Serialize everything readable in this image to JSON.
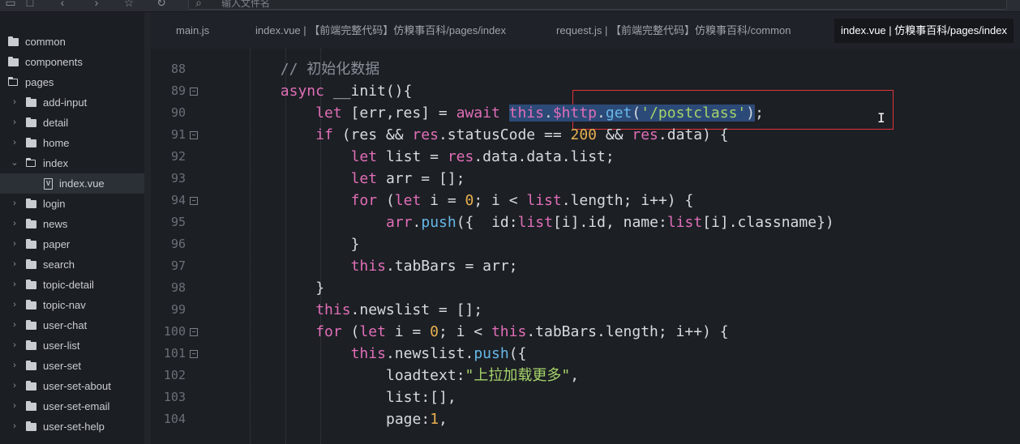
{
  "toolbar": {
    "search_placeholder": "输入文件名"
  },
  "sidebar": {
    "items": [
      {
        "label": "common",
        "type": "folder",
        "depth": 0,
        "expanded": false,
        "has_chevron": false
      },
      {
        "label": "components",
        "type": "folder",
        "depth": 0,
        "expanded": false,
        "has_chevron": false
      },
      {
        "label": "pages",
        "type": "folder",
        "depth": 0,
        "expanded": true,
        "has_chevron": false
      },
      {
        "label": "add-input",
        "type": "folder",
        "depth": 1,
        "expanded": false,
        "has_chevron": true
      },
      {
        "label": "detail",
        "type": "folder",
        "depth": 1,
        "expanded": false,
        "has_chevron": true
      },
      {
        "label": "home",
        "type": "folder",
        "depth": 1,
        "expanded": false,
        "has_chevron": true
      },
      {
        "label": "index",
        "type": "folder",
        "depth": 1,
        "expanded": true,
        "has_chevron": true
      },
      {
        "label": "index.vue",
        "type": "vue",
        "depth": 2,
        "selected": true
      },
      {
        "label": "login",
        "type": "folder",
        "depth": 1,
        "expanded": false,
        "has_chevron": true
      },
      {
        "label": "news",
        "type": "folder",
        "depth": 1,
        "expanded": false,
        "has_chevron": true
      },
      {
        "label": "paper",
        "type": "folder",
        "depth": 1,
        "expanded": false,
        "has_chevron": true
      },
      {
        "label": "search",
        "type": "folder",
        "depth": 1,
        "expanded": false,
        "has_chevron": true
      },
      {
        "label": "topic-detail",
        "type": "folder",
        "depth": 1,
        "expanded": false,
        "has_chevron": true
      },
      {
        "label": "topic-nav",
        "type": "folder",
        "depth": 1,
        "expanded": false,
        "has_chevron": true
      },
      {
        "label": "user-chat",
        "type": "folder",
        "depth": 1,
        "expanded": false,
        "has_chevron": true
      },
      {
        "label": "user-list",
        "type": "folder",
        "depth": 1,
        "expanded": false,
        "has_chevron": true
      },
      {
        "label": "user-set",
        "type": "folder",
        "depth": 1,
        "expanded": false,
        "has_chevron": true
      },
      {
        "label": "user-set-about",
        "type": "folder",
        "depth": 1,
        "expanded": false,
        "has_chevron": true
      },
      {
        "label": "user-set-email",
        "type": "folder",
        "depth": 1,
        "expanded": false,
        "has_chevron": true
      },
      {
        "label": "user-set-help",
        "type": "folder",
        "depth": 1,
        "expanded": false,
        "has_chevron": true
      }
    ]
  },
  "tabs": [
    {
      "label": "main.js",
      "active": false
    },
    {
      "label": "index.vue | 【前端完整代码】仿糗事百科/pages/index",
      "active": false
    },
    {
      "label": "request.js | 【前端完整代码】仿糗事百科/common",
      "active": false
    },
    {
      "label": "index.vue | 仿糗事百科/pages/index",
      "active": true
    }
  ],
  "editor": {
    "lines": [
      {
        "num": "88",
        "fold": false,
        "indent": 2,
        "tokens": [
          [
            "cm",
            "// 初始化数据"
          ]
        ]
      },
      {
        "num": "89",
        "fold": true,
        "indent": 2,
        "tokens": [
          [
            "kw",
            "async"
          ],
          [
            "op",
            " __init(){"
          ]
        ]
      },
      {
        "num": "90",
        "fold": false,
        "indent": 3,
        "tokens": [
          [
            "kw",
            "let"
          ],
          [
            "op",
            " [err,res] = "
          ],
          [
            "kw",
            "await"
          ],
          [
            "op",
            " "
          ],
          [
            "kw sel",
            "this"
          ],
          [
            "op sel",
            "."
          ],
          [
            "kw sel",
            "$http"
          ],
          [
            "op sel",
            "."
          ],
          [
            "fn sel",
            "get"
          ],
          [
            "op sel",
            "("
          ],
          [
            "str sel",
            "'/postclass'"
          ],
          [
            "op sel",
            ")"
          ],
          [
            "op",
            ";"
          ]
        ]
      },
      {
        "num": "91",
        "fold": true,
        "indent": 3,
        "tokens": [
          [
            "kw",
            "if"
          ],
          [
            "op",
            " (res && "
          ],
          [
            "kw",
            "res"
          ],
          [
            "op",
            ".statusCode == "
          ],
          [
            "num",
            "200"
          ],
          [
            "op",
            " && "
          ],
          [
            "kw",
            "res"
          ],
          [
            "op",
            ".data) {"
          ]
        ]
      },
      {
        "num": "92",
        "fold": false,
        "indent": 4,
        "tokens": [
          [
            "kw",
            "let"
          ],
          [
            "op",
            " list = "
          ],
          [
            "kw",
            "res"
          ],
          [
            "op",
            ".data.data.list;"
          ]
        ]
      },
      {
        "num": "93",
        "fold": false,
        "indent": 4,
        "tokens": [
          [
            "kw",
            "let"
          ],
          [
            "op",
            " arr = [];"
          ]
        ]
      },
      {
        "num": "94",
        "fold": true,
        "indent": 4,
        "tokens": [
          [
            "kw",
            "for"
          ],
          [
            "op",
            " ("
          ],
          [
            "kw",
            "let"
          ],
          [
            "op",
            " i = "
          ],
          [
            "num",
            "0"
          ],
          [
            "op",
            "; i < "
          ],
          [
            "kw",
            "list"
          ],
          [
            "op",
            ".length; i++) {"
          ]
        ]
      },
      {
        "num": "95",
        "fold": false,
        "indent": 5,
        "tokens": [
          [
            "kw",
            "arr"
          ],
          [
            "op",
            "."
          ],
          [
            "fn",
            "push"
          ],
          [
            "op",
            "({  id:"
          ],
          [
            "kw",
            "list"
          ],
          [
            "op",
            "[i].id, name:"
          ],
          [
            "kw",
            "list"
          ],
          [
            "op",
            "[i].classname})"
          ]
        ]
      },
      {
        "num": "96",
        "fold": false,
        "indent": 4,
        "tokens": [
          [
            "op",
            "}"
          ]
        ]
      },
      {
        "num": "97",
        "fold": false,
        "indent": 4,
        "tokens": [
          [
            "kw",
            "this"
          ],
          [
            "op",
            ".tabBars = arr;"
          ]
        ]
      },
      {
        "num": "98",
        "fold": false,
        "indent": 3,
        "tokens": [
          [
            "op",
            "}"
          ]
        ]
      },
      {
        "num": "99",
        "fold": false,
        "indent": 3,
        "tokens": [
          [
            "kw",
            "this"
          ],
          [
            "op",
            ".newslist = [];"
          ]
        ]
      },
      {
        "num": "100",
        "fold": true,
        "indent": 3,
        "tokens": [
          [
            "kw",
            "for"
          ],
          [
            "op",
            " ("
          ],
          [
            "kw",
            "let"
          ],
          [
            "op",
            " i = "
          ],
          [
            "num",
            "0"
          ],
          [
            "op",
            "; i < "
          ],
          [
            "kw",
            "this"
          ],
          [
            "op",
            ".tabBars.length; i++) {"
          ]
        ]
      },
      {
        "num": "101",
        "fold": true,
        "indent": 4,
        "tokens": [
          [
            "kw",
            "this"
          ],
          [
            "op",
            ".newslist."
          ],
          [
            "fn",
            "push"
          ],
          [
            "op",
            "({"
          ]
        ]
      },
      {
        "num": "102",
        "fold": false,
        "indent": 5,
        "tokens": [
          [
            "op",
            "loadtext:"
          ],
          [
            "str",
            "\"上拉加载更多\""
          ],
          [
            "op",
            ","
          ]
        ]
      },
      {
        "num": "103",
        "fold": false,
        "indent": 5,
        "tokens": [
          [
            "op",
            "list:[],"
          ]
        ]
      },
      {
        "num": "104",
        "fold": false,
        "indent": 5,
        "tokens": [
          [
            "op",
            "page:"
          ],
          [
            "num",
            "1"
          ],
          [
            "op",
            ","
          ]
        ]
      }
    ]
  },
  "colors": {
    "keyword": "#e06eb7",
    "function": "#66b8e8",
    "string": "#a6d36a",
    "number": "#e8b050",
    "comment": "#8a8f98",
    "highlight_box": "#e0343a",
    "selection": "#2c4a78"
  },
  "icons": [
    "sidebar-toggle-icon",
    "new-file-icon",
    "back-icon",
    "forward-icon",
    "star-icon",
    "refresh-icon",
    "search-icon",
    "text-cursor-icon"
  ]
}
